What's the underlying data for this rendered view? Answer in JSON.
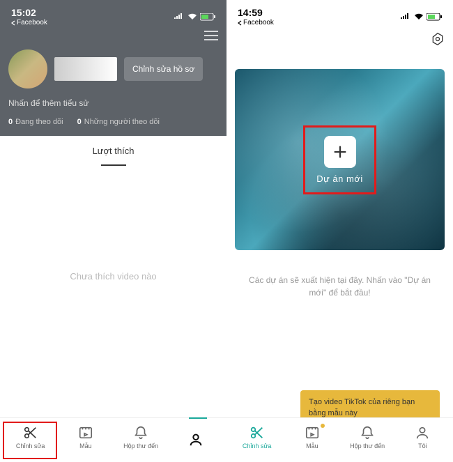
{
  "left": {
    "status": {
      "time": "15:02",
      "back": "Facebook"
    },
    "profile": {
      "edit_label": "Chỉnh sửa hồ sơ",
      "bio_prompt": "Nhấn để thêm tiểu sử",
      "following_count": "0",
      "following_label": "Đang theo dõi",
      "followers_count": "0",
      "followers_label": "Những người theo dõi"
    },
    "likes": {
      "title": "Lượt thích",
      "empty": "Chưa thích video nào"
    },
    "nav": {
      "edit": "Chỉnh sửa",
      "templates": "Mẫu",
      "inbox": "Hộp thư đến",
      "me": ""
    }
  },
  "right": {
    "status": {
      "time": "14:59",
      "back": "Facebook"
    },
    "project": {
      "label": "Dự án mới",
      "hint": "Các dự án sẽ xuất hiện tại đây. Nhấn vào \"Dự án mới\" để bắt đầu!",
      "tooltip": "Tạo video TikTok của riêng bạn bằng mẫu này"
    },
    "nav": {
      "edit": "Chỉnh sửa",
      "templates": "Mẫu",
      "inbox": "Hộp thư đến",
      "me": "Tôi"
    }
  }
}
